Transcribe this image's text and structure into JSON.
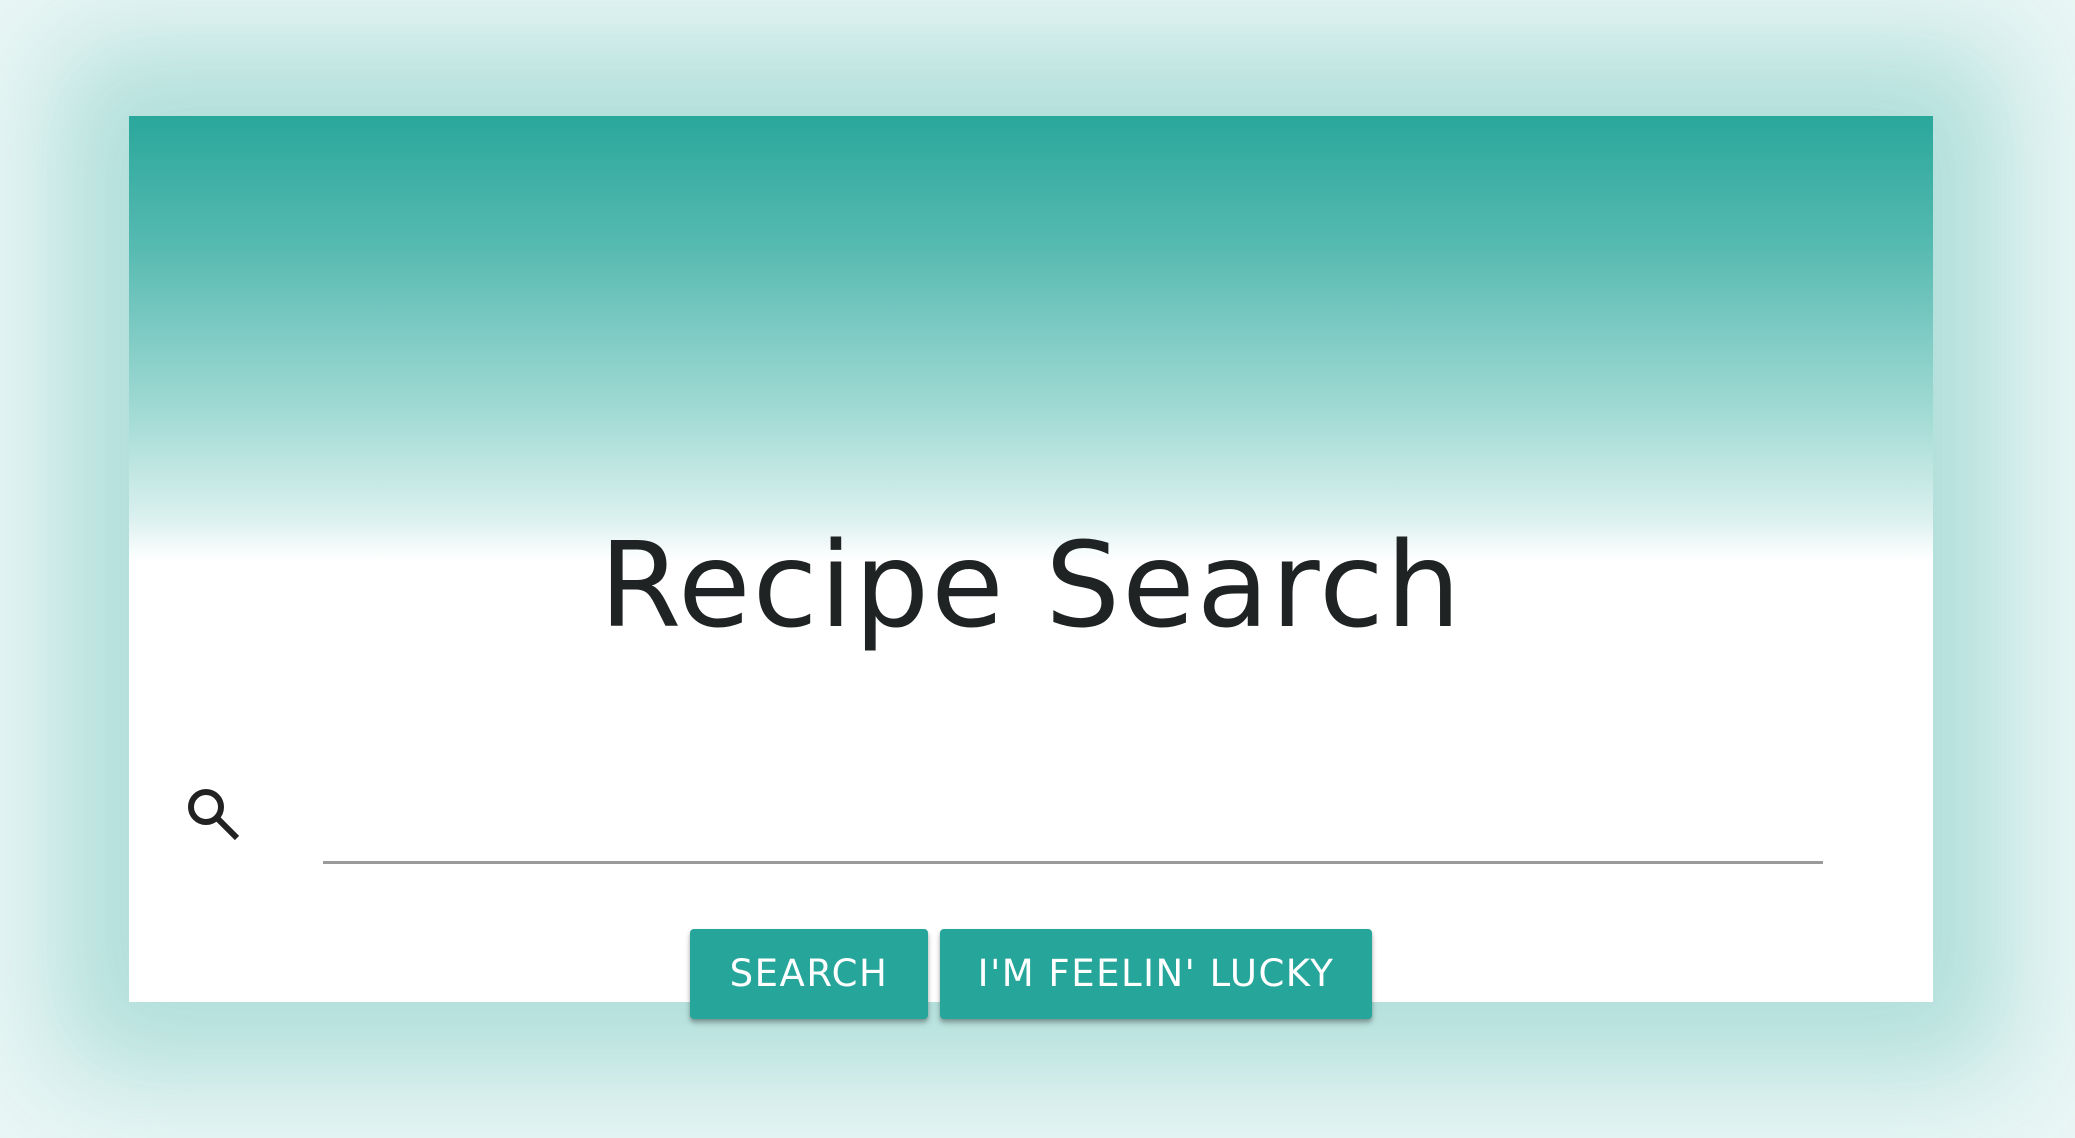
{
  "page": {
    "title": "Recipe Search"
  },
  "search": {
    "placeholder": "",
    "value": "",
    "icon": "search-icon"
  },
  "buttons": {
    "search_label": "SEARCH",
    "lucky_label": "I'M FEELIN' LUCKY"
  },
  "colors": {
    "accent": "#26a69a",
    "background": "#e9f6f5",
    "title_text": "#1f2323"
  }
}
